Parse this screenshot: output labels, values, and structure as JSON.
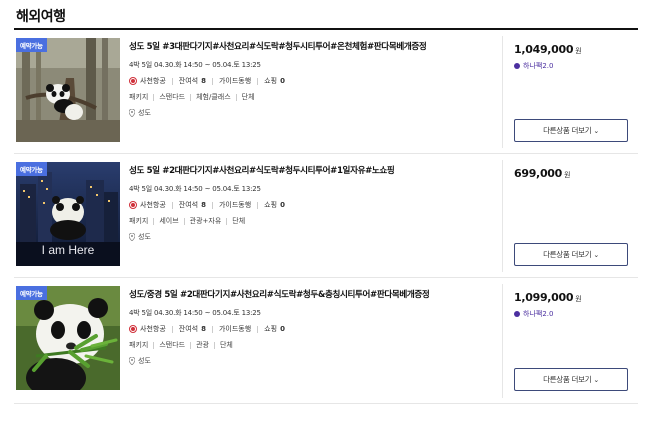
{
  "section_title": "해외여행",
  "products": [
    {
      "badge": "예약가능",
      "title": "성도 5일 #3대판다기지#사천요리#식도락#청두시티투어#온천체험#판다목베개증정",
      "dates": "4박 5일   04.30.화 14:50 ~ 05.04.토 13:25",
      "airline": "사천항공",
      "seats_label": "잔여석",
      "seats": "8",
      "guide": "가이드동행",
      "shopping_label": "쇼핑",
      "shopping": "0",
      "tags": [
        "패키지",
        "스탠다드",
        "체험/클래스",
        "단체"
      ],
      "location": "성도",
      "price": "1,049,000",
      "won": "원",
      "point": "하나팩2.0",
      "more_button": "다른상품 더보기",
      "image": "panda-tree"
    },
    {
      "badge": "예약가능",
      "title": "성도 5일 #2대판다기지#사천요리#식도락#청두시티투어#1일자유#노쇼핑",
      "dates": "4박 5일   04.30.화 14:50 ~ 05.04.토 13:25",
      "airline": "사천항공",
      "seats_label": "잔여석",
      "seats": "8",
      "guide": "가이드동행",
      "shopping_label": "쇼핑",
      "shopping": "0",
      "tags": [
        "패키지",
        "세이브",
        "관광+자유",
        "단체"
      ],
      "location": "성도",
      "price": "699,000",
      "won": "원",
      "point": "",
      "more_button": "다른상품 더보기",
      "image": "city-night",
      "image_text": "I am Here"
    },
    {
      "badge": "예약가능",
      "title": "성도/중경 5일 #2대판다기지#사천요리#식도락#청두&충칭시티투어#판다목베개증정",
      "dates": "4박 5일   04.30.화 14:50 ~ 05.04.토 13:25",
      "airline": "사천항공",
      "seats_label": "잔여석",
      "seats": "8",
      "guide": "가이드동행",
      "shopping_label": "쇼핑",
      "shopping": "0",
      "tags": [
        "패키지",
        "스탠다드",
        "관광",
        "단체"
      ],
      "location": "성도",
      "price": "1,099,000",
      "won": "원",
      "point": "하나팩2.0",
      "more_button": "다른상품 더보기",
      "image": "panda-bamboo"
    }
  ],
  "colors": {
    "badge": "#4a6fe0",
    "point": "#4b2fa0",
    "button_border": "#3d4a7a",
    "airline": "#d0303a"
  }
}
